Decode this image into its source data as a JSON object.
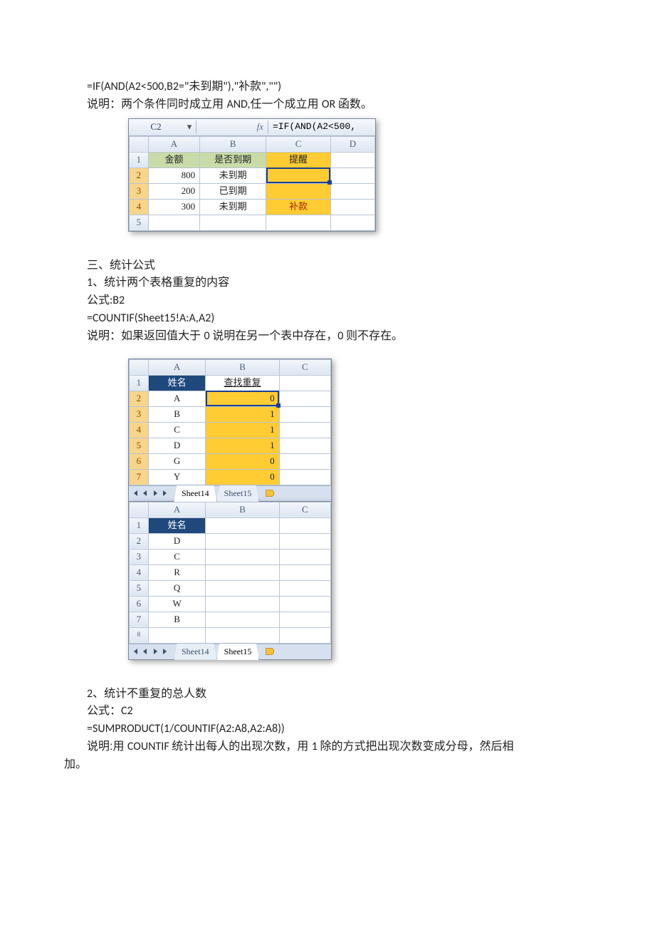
{
  "text": {
    "formula1": "=IF(AND(A2<500,B2=\"未到期\"),\"补款\",\"\")",
    "explain1_a": "说明：两个条件同时成立用 ",
    "explain1_b": "AND,",
    "explain1_c": "任一个成立用 ",
    "explain1_d": "OR ",
    "explain1_e": "函数。",
    "sec3": "三、统计公式",
    "sec3_1": "1、统计两个表格重复的内容",
    "formula2_label": "公式:B2",
    "formula2": "=COUNTIF(Sheet15!A:A,A2)",
    "explain2_a": "说明：如果返回值大于 ",
    "explain2_b": "0 ",
    "explain2_c": "说明在另一个表中存在，",
    "explain2_d": "0 ",
    "explain2_e": "则不存在。",
    "sec3_2": "2、统计不重复的总人数",
    "formula3_label": "公式：C2",
    "formula3": "=SUMPRODUCT(1/COUNTIF(A2:A8,A2:A8))",
    "explain3_a": "说明:用 ",
    "explain3_b": "COUNTIF ",
    "explain3_c": "统计出每人的出现次数，用 ",
    "explain3_d": "1 ",
    "explain3_e": "除的方式把出现次数变成分母，然后相",
    "explain3_line2": "加。"
  },
  "ss1": {
    "activeCell": "C2",
    "fx": "fx",
    "formula": "=IF(AND(A2<500,",
    "cols": [
      "A",
      "B",
      "C",
      "D"
    ],
    "header": [
      "金额",
      "是否到期",
      "提醒",
      ""
    ],
    "rows": [
      {
        "n": "2",
        "a": "800",
        "b": "未到期",
        "c": ""
      },
      {
        "n": "3",
        "a": "200",
        "b": "已到期",
        "c": ""
      },
      {
        "n": "4",
        "a": "300",
        "b": "未到期",
        "c": "补款"
      },
      {
        "n": "5",
        "a": "",
        "b": "",
        "c": ""
      }
    ]
  },
  "ss2": {
    "cols": [
      "A",
      "B",
      "C"
    ],
    "header": {
      "a": "姓名",
      "b": "查找重复"
    },
    "rows": [
      {
        "n": "2",
        "a": "A",
        "b": "0"
      },
      {
        "n": "3",
        "a": "B",
        "b": "1"
      },
      {
        "n": "4",
        "a": "C",
        "b": "1"
      },
      {
        "n": "5",
        "a": "D",
        "b": "1"
      },
      {
        "n": "6",
        "a": "G",
        "b": "0"
      },
      {
        "n": "7",
        "a": "Y",
        "b": "0"
      }
    ],
    "tabs": {
      "t1": "Sheet14",
      "t2": "Sheet15"
    }
  },
  "ss3": {
    "cols": [
      "A",
      "B",
      "C"
    ],
    "header": {
      "a": "姓名"
    },
    "rows": [
      {
        "n": "2",
        "a": "D"
      },
      {
        "n": "3",
        "a": "C"
      },
      {
        "n": "4",
        "a": "R"
      },
      {
        "n": "5",
        "a": "Q"
      },
      {
        "n": "6",
        "a": "W"
      },
      {
        "n": "7",
        "a": "B"
      },
      {
        "n": "8",
        "a": ""
      }
    ],
    "tabs": {
      "t1": "Sheet14",
      "t2": "Sheet15"
    }
  }
}
